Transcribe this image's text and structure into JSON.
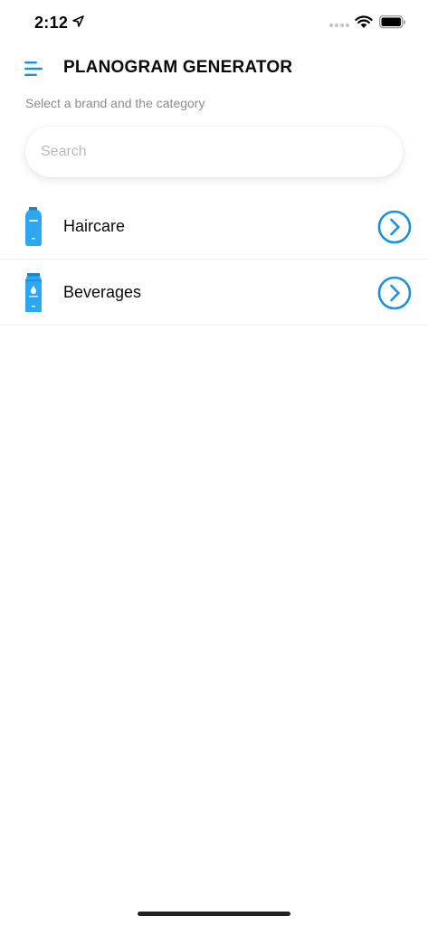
{
  "status_bar": {
    "time": "2:12"
  },
  "header": {
    "title": "PLANOGRAM GENERATOR",
    "subtitle": "Select a brand and the category"
  },
  "search": {
    "placeholder": "Search",
    "value": ""
  },
  "categories": [
    {
      "label": "Haircare",
      "icon": "shampoo-bottle-icon"
    },
    {
      "label": "Beverages",
      "icon": "beverage-carton-icon"
    }
  ],
  "colors": {
    "accent": "#1E8FE0",
    "product": "#2DA8F0",
    "text": "#0B0B0B",
    "muted": "#8C8C8C"
  }
}
